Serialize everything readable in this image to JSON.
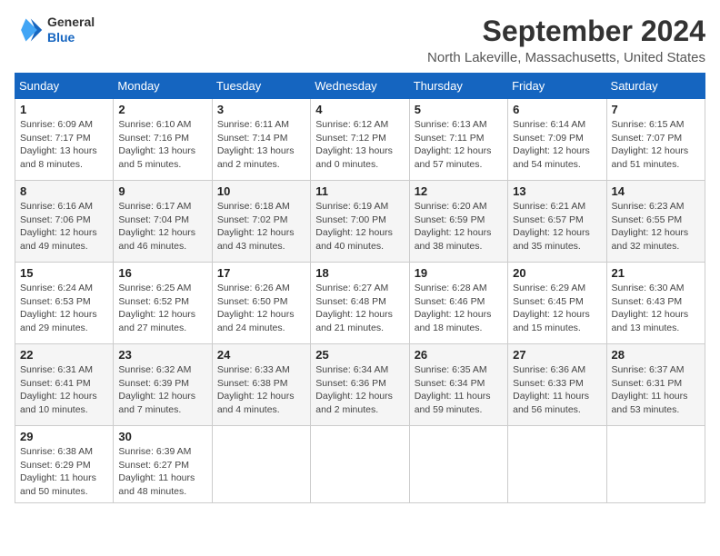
{
  "logo": {
    "line1": "General",
    "line2": "Blue"
  },
  "title": "September 2024",
  "subtitle": "North Lakeville, Massachusetts, United States",
  "days_of_week": [
    "Sunday",
    "Monday",
    "Tuesday",
    "Wednesday",
    "Thursday",
    "Friday",
    "Saturday"
  ],
  "weeks": [
    [
      {
        "day": "1",
        "info": "Sunrise: 6:09 AM\nSunset: 7:17 PM\nDaylight: 13 hours\nand 8 minutes."
      },
      {
        "day": "2",
        "info": "Sunrise: 6:10 AM\nSunset: 7:16 PM\nDaylight: 13 hours\nand 5 minutes."
      },
      {
        "day": "3",
        "info": "Sunrise: 6:11 AM\nSunset: 7:14 PM\nDaylight: 13 hours\nand 2 minutes."
      },
      {
        "day": "4",
        "info": "Sunrise: 6:12 AM\nSunset: 7:12 PM\nDaylight: 13 hours\nand 0 minutes."
      },
      {
        "day": "5",
        "info": "Sunrise: 6:13 AM\nSunset: 7:11 PM\nDaylight: 12 hours\nand 57 minutes."
      },
      {
        "day": "6",
        "info": "Sunrise: 6:14 AM\nSunset: 7:09 PM\nDaylight: 12 hours\nand 54 minutes."
      },
      {
        "day": "7",
        "info": "Sunrise: 6:15 AM\nSunset: 7:07 PM\nDaylight: 12 hours\nand 51 minutes."
      }
    ],
    [
      {
        "day": "8",
        "info": "Sunrise: 6:16 AM\nSunset: 7:06 PM\nDaylight: 12 hours\nand 49 minutes."
      },
      {
        "day": "9",
        "info": "Sunrise: 6:17 AM\nSunset: 7:04 PM\nDaylight: 12 hours\nand 46 minutes."
      },
      {
        "day": "10",
        "info": "Sunrise: 6:18 AM\nSunset: 7:02 PM\nDaylight: 12 hours\nand 43 minutes."
      },
      {
        "day": "11",
        "info": "Sunrise: 6:19 AM\nSunset: 7:00 PM\nDaylight: 12 hours\nand 40 minutes."
      },
      {
        "day": "12",
        "info": "Sunrise: 6:20 AM\nSunset: 6:59 PM\nDaylight: 12 hours\nand 38 minutes."
      },
      {
        "day": "13",
        "info": "Sunrise: 6:21 AM\nSunset: 6:57 PM\nDaylight: 12 hours\nand 35 minutes."
      },
      {
        "day": "14",
        "info": "Sunrise: 6:23 AM\nSunset: 6:55 PM\nDaylight: 12 hours\nand 32 minutes."
      }
    ],
    [
      {
        "day": "15",
        "info": "Sunrise: 6:24 AM\nSunset: 6:53 PM\nDaylight: 12 hours\nand 29 minutes."
      },
      {
        "day": "16",
        "info": "Sunrise: 6:25 AM\nSunset: 6:52 PM\nDaylight: 12 hours\nand 27 minutes."
      },
      {
        "day": "17",
        "info": "Sunrise: 6:26 AM\nSunset: 6:50 PM\nDaylight: 12 hours\nand 24 minutes."
      },
      {
        "day": "18",
        "info": "Sunrise: 6:27 AM\nSunset: 6:48 PM\nDaylight: 12 hours\nand 21 minutes."
      },
      {
        "day": "19",
        "info": "Sunrise: 6:28 AM\nSunset: 6:46 PM\nDaylight: 12 hours\nand 18 minutes."
      },
      {
        "day": "20",
        "info": "Sunrise: 6:29 AM\nSunset: 6:45 PM\nDaylight: 12 hours\nand 15 minutes."
      },
      {
        "day": "21",
        "info": "Sunrise: 6:30 AM\nSunset: 6:43 PM\nDaylight: 12 hours\nand 13 minutes."
      }
    ],
    [
      {
        "day": "22",
        "info": "Sunrise: 6:31 AM\nSunset: 6:41 PM\nDaylight: 12 hours\nand 10 minutes."
      },
      {
        "day": "23",
        "info": "Sunrise: 6:32 AM\nSunset: 6:39 PM\nDaylight: 12 hours\nand 7 minutes."
      },
      {
        "day": "24",
        "info": "Sunrise: 6:33 AM\nSunset: 6:38 PM\nDaylight: 12 hours\nand 4 minutes."
      },
      {
        "day": "25",
        "info": "Sunrise: 6:34 AM\nSunset: 6:36 PM\nDaylight: 12 hours\nand 2 minutes."
      },
      {
        "day": "26",
        "info": "Sunrise: 6:35 AM\nSunset: 6:34 PM\nDaylight: 11 hours\nand 59 minutes."
      },
      {
        "day": "27",
        "info": "Sunrise: 6:36 AM\nSunset: 6:33 PM\nDaylight: 11 hours\nand 56 minutes."
      },
      {
        "day": "28",
        "info": "Sunrise: 6:37 AM\nSunset: 6:31 PM\nDaylight: 11 hours\nand 53 minutes."
      }
    ],
    [
      {
        "day": "29",
        "info": "Sunrise: 6:38 AM\nSunset: 6:29 PM\nDaylight: 11 hours\nand 50 minutes."
      },
      {
        "day": "30",
        "info": "Sunrise: 6:39 AM\nSunset: 6:27 PM\nDaylight: 11 hours\nand 48 minutes."
      },
      null,
      null,
      null,
      null,
      null
    ]
  ]
}
